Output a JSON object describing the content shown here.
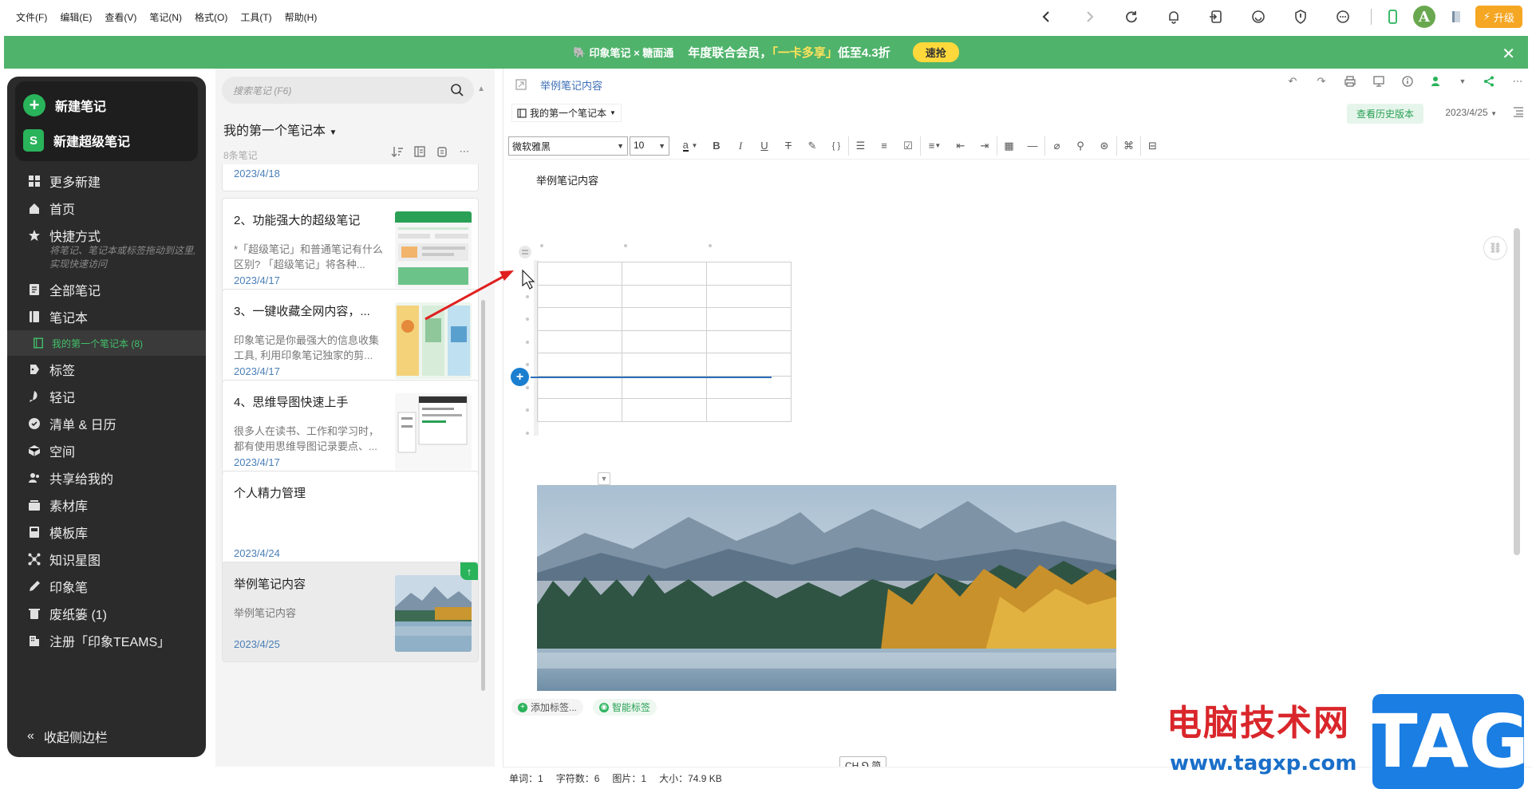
{
  "menubar": {
    "items": [
      "文件(F)",
      "编辑(E)",
      "查看(V)",
      "笔记(N)",
      "格式(O)",
      "工具(T)",
      "帮助(H)"
    ],
    "upgrade_label": "升级",
    "avatar_letter": "A"
  },
  "banner": {
    "brand": "印象笔记 × 糖面通",
    "promo_prefix": "年度联合会员",
    "promo_highlight": "「一卡多享」",
    "promo_suffix": "低至4.3折",
    "cta": "速抢",
    "close": "✕"
  },
  "sidebar": {
    "new_note": "新建笔记",
    "new_super_note": "新建超级笔记",
    "items": [
      {
        "label": "更多新建",
        "icon": "grid-icon"
      },
      {
        "label": "首页",
        "icon": "home-icon"
      },
      {
        "label": "快捷方式",
        "icon": "star-icon"
      }
    ],
    "shortcut_hint": "将笔记、笔记本或标签拖动到这里, 实现快速访问",
    "items2": [
      {
        "label": "全部笔记",
        "icon": "note-icon"
      },
      {
        "label": "笔记本",
        "icon": "notebook-icon"
      }
    ],
    "sub_notebook": "我的第一个笔记本  (8)",
    "items3": [
      {
        "label": "标签",
        "icon": "tag-icon"
      },
      {
        "label": "轻记",
        "icon": "quick-note-icon"
      },
      {
        "label": "清单 & 日历",
        "icon": "checklist-icon"
      },
      {
        "label": "空间",
        "icon": "space-icon"
      },
      {
        "label": "共享给我的",
        "icon": "shared-icon"
      },
      {
        "label": "素材库",
        "icon": "material-icon"
      },
      {
        "label": "模板库",
        "icon": "template-icon"
      },
      {
        "label": "知识星图",
        "icon": "knowledge-graph-icon"
      },
      {
        "label": "印象笔",
        "icon": "pen-icon"
      },
      {
        "label": "废纸篓  (1)",
        "icon": "trash-icon"
      },
      {
        "label": "注册「印象TEAMS」",
        "icon": "building-icon"
      }
    ],
    "collapse": "收起侧边栏"
  },
  "notelist": {
    "search_placeholder": "搜索笔记 (F6)",
    "notebook_title": "我的第一个笔记本",
    "count": "8条笔记",
    "top_partial_date": "2023/4/18",
    "cards": [
      {
        "title": "2、功能强大的超级笔记",
        "snippet": "*「超级笔记」和普通笔记有什么区别? 「超级笔记」将各种...",
        "date": "2023/4/17"
      },
      {
        "title": "3、一键收藏全网内容，...",
        "snippet": "印象笔记是你最强大的信息收集工具, 利用印象笔记独家的剪...",
        "date": "2023/4/17"
      },
      {
        "title": "4、思维导图快速上手",
        "snippet": "很多人在读书、工作和学习时，都有使用思维导图记录要点、...",
        "date": "2023/4/17"
      },
      {
        "title": "个人精力管理",
        "snippet": "",
        "date": "2023/4/24"
      },
      {
        "title": "举例笔记内容",
        "snippet": "举例笔记内容",
        "date": "2023/4/25"
      }
    ]
  },
  "editor": {
    "title": "举例笔记内容",
    "notebook": "我的第一个笔记本",
    "history": "查看历史版本",
    "date": "2023/4/25",
    "font": "微软雅黑",
    "size": "10",
    "body_text": "举例笔记内容",
    "add_tag": "添加标签...",
    "smart_tag": "智能标签",
    "ime": "CH ⅁ 简",
    "status": {
      "words": "单词：1",
      "chars": "字符数：6",
      "images": "图片：1",
      "size": "大小：74.9 KB"
    }
  },
  "watermark": {
    "site": "电脑技术网",
    "url": "www.tagxp.com",
    "tag": "TAG"
  }
}
